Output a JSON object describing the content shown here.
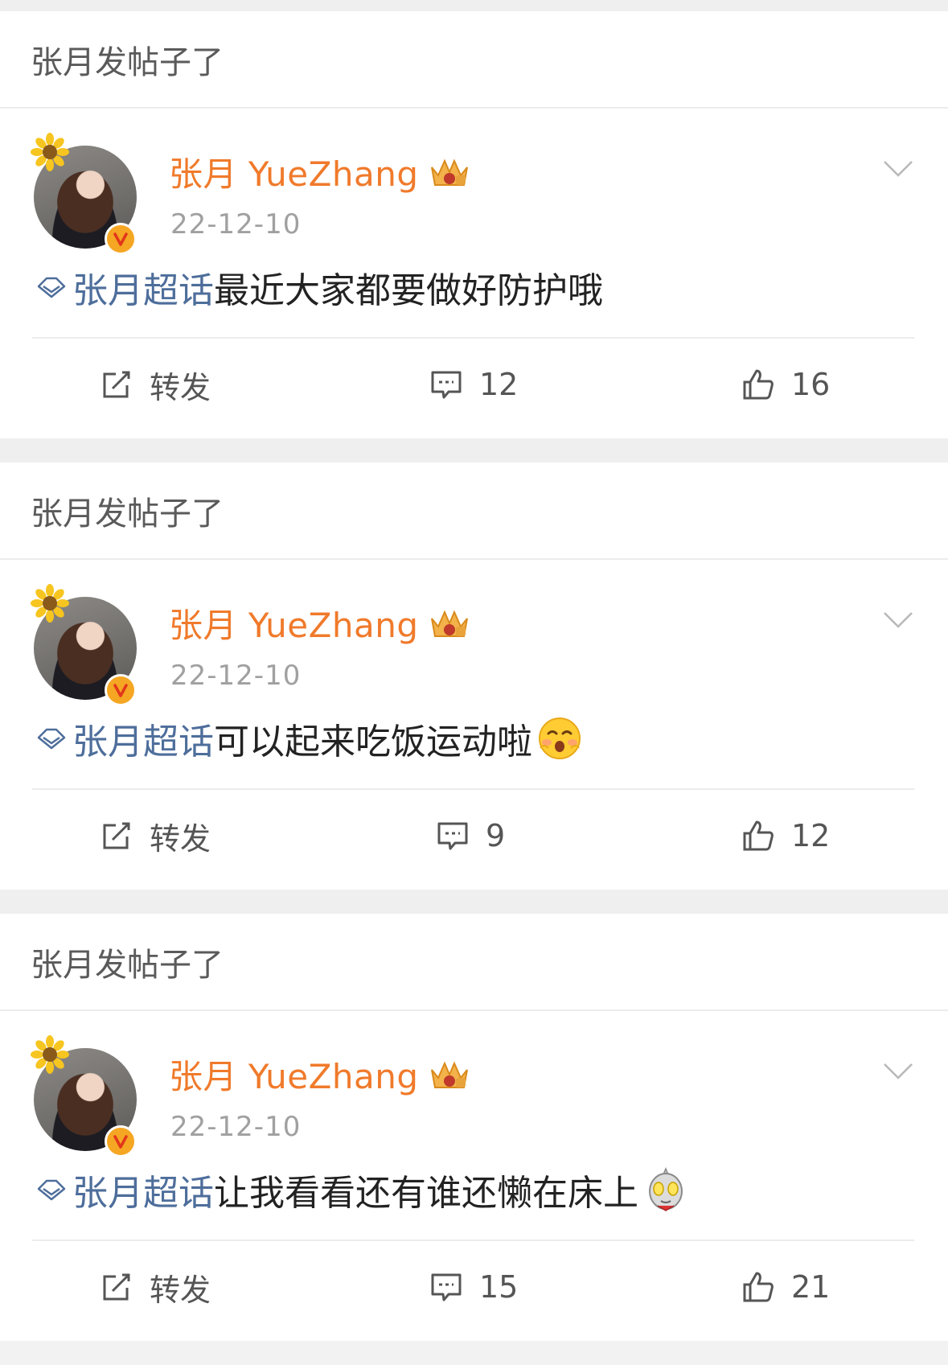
{
  "posts": [
    {
      "header": "张月发帖子了",
      "author": "张月 YueZhang",
      "date": "22-12-10",
      "topic": "张月超话",
      "text": "最近大家都要做好防护哦",
      "emoji": "",
      "share_label": "转发",
      "comments": "12",
      "likes": "16"
    },
    {
      "header": "张月发帖子了",
      "author": "张月 YueZhang",
      "date": "22-12-10",
      "topic": "张月超话",
      "text": "可以起来吃饭运动啦",
      "emoji": "smiling-blush-emoji",
      "share_label": "转发",
      "comments": "9",
      "likes": "12"
    },
    {
      "header": "张月发帖子了",
      "author": "张月 YueZhang",
      "date": "22-12-10",
      "topic": "张月超话",
      "text": "让我看看还有谁还懒在床上",
      "emoji": "ultraman-emoji",
      "share_label": "转发",
      "comments": "15",
      "likes": "21"
    }
  ],
  "colors": {
    "name": "#f07a2b",
    "topic": "#4e6e9b",
    "date": "#a0a0a0",
    "badge": "#f5a623"
  }
}
